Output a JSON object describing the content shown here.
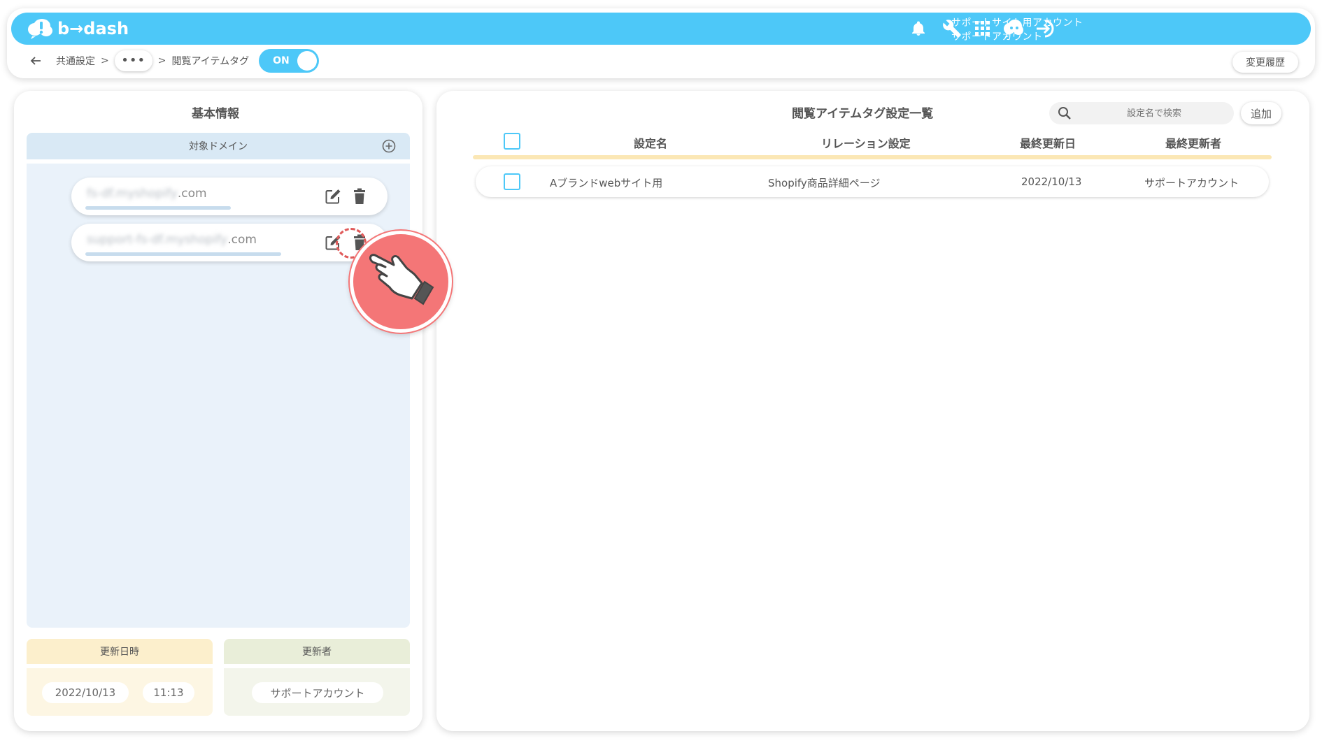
{
  "app": {
    "brand": "b→dash"
  },
  "header": {
    "account_line1": "サポートサイト用アカウント",
    "account_line2": "サポートアカウント",
    "icons": [
      "bell-icon",
      "wrench-icon",
      "apps-grid-icon",
      "chat-bot-icon",
      "logout-icon"
    ]
  },
  "breadcrumb": {
    "root": "共通設定",
    "sep": ">",
    "more": "•••",
    "current": "閲覧アイテムタグ",
    "toggle_label": "ON"
  },
  "history_button": "変更履歴",
  "left_panel": {
    "title": "基本情報",
    "domain_header": "対象ドメイン",
    "domains": [
      {
        "blurred": "fs-df.myshopify",
        "suffix": ".com"
      },
      {
        "blurred": "support-fs-df.myshopify",
        "suffix": ".com"
      }
    ],
    "updated_at_label": "更新日時",
    "updated_date": "2022/10/13",
    "updated_time": "11:13",
    "updated_by_label": "更新者",
    "updated_by": "サポートアカウント"
  },
  "right_panel": {
    "title": "閲覧アイテムタグ設定一覧",
    "search_placeholder": "設定名で検索",
    "add_button": "追加",
    "columns": {
      "name": "設定名",
      "relation": "リレーション設定",
      "updated": "最終更新日",
      "updater": "最終更新者"
    },
    "rows": [
      {
        "name": "Aブランドwebサイト用",
        "relation": "Shopify商品詳細ページ",
        "updated": "2022/10/13",
        "updater": "サポートアカウント"
      }
    ]
  },
  "colors": {
    "accent": "#4dc8f8",
    "left_title_underline": "#c9e0ef",
    "right_title_underline": "#fbe7b5",
    "hint": "#f47677"
  }
}
